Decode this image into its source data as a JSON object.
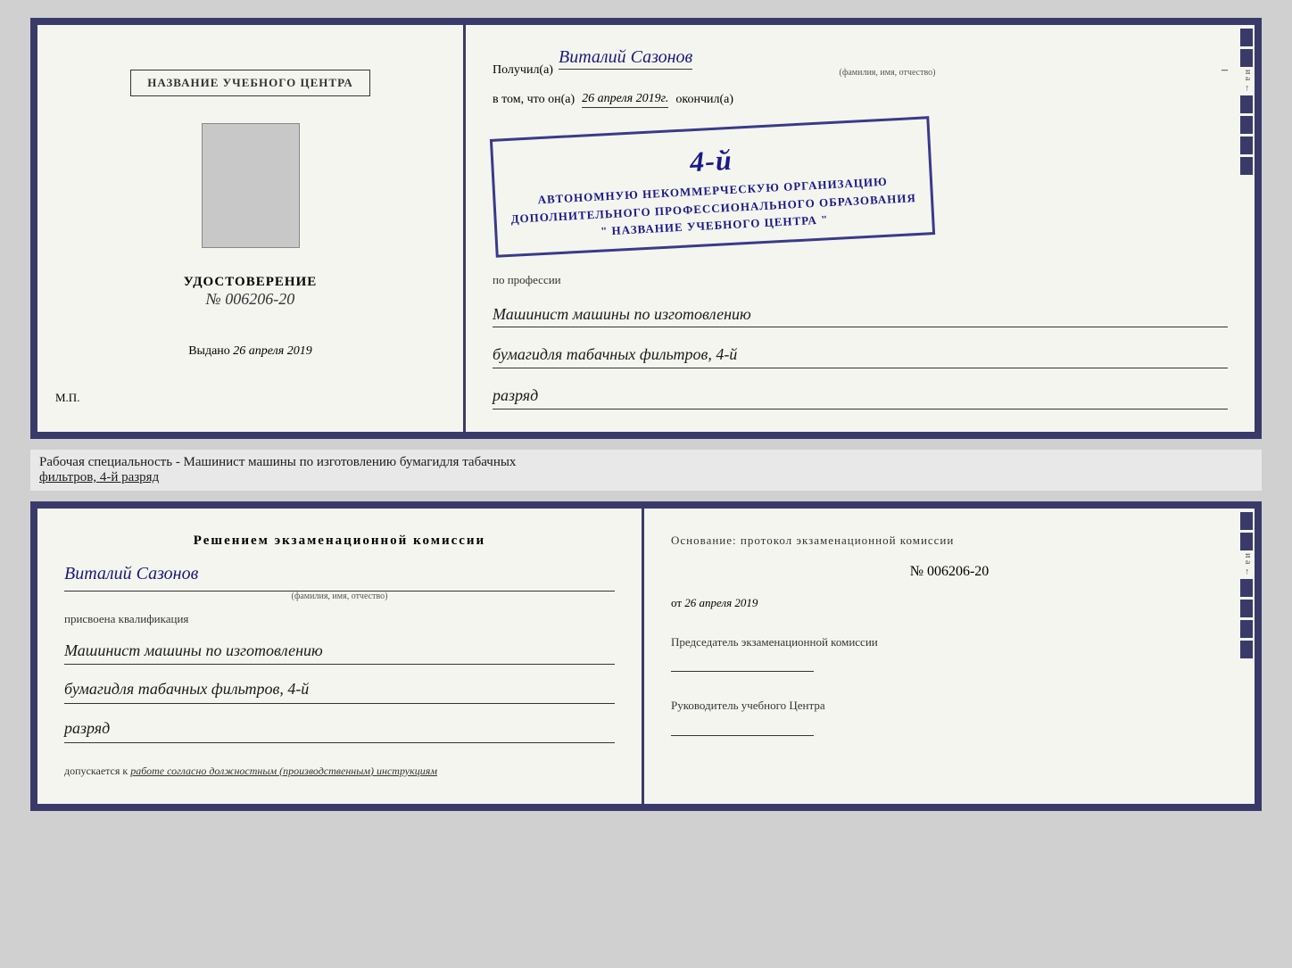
{
  "top_left": {
    "header_label": "НАЗВАНИЕ УЧЕБНОГО ЦЕНТРА",
    "udost_title": "УДОСТОВЕРЕНИЕ",
    "udost_number": "№ 006206-20",
    "issued_label": "Выдано",
    "issued_date": "26 апреля 2019",
    "mp_label": "М.П."
  },
  "top_right": {
    "received_prefix": "Получил(а)",
    "recipient_name": "Виталий Сазонов",
    "fio_hint": "(фамилия, имя, отчество)",
    "in_that_prefix": "в том, что он(а)",
    "date_value": "26 апреля 2019г.",
    "finished_label": "окончил(а)",
    "stamp_line1": "АВТОНОМНУЮ НЕКОММЕРЧЕСКУЮ ОРГАНИЗАЦИЮ",
    "stamp_line2": "ДОПОЛНИТЕЛЬНОГО ПРОФЕССИОНАЛЬНОГО ОБРАЗОВАНИЯ",
    "stamp_line3": "\" НАЗВАНИЕ УЧЕБНОГО ЦЕНТРА \"",
    "stamp_number": "4-й",
    "profession_label": "по профессии",
    "profession_line1": "Машинист машины по изготовлению",
    "profession_line2": "бумагидля табачных фильтров, 4-й",
    "profession_line3": "разряд"
  },
  "caption": {
    "text": "Рабочая специальность - Машинист машины по изготовлению бумагидля табачных",
    "text2": "фильтров, 4-й разряд"
  },
  "bottom_left": {
    "decision_header": "Решением  экзаменационной  комиссии",
    "person_name": "Виталий Сазонов",
    "fio_hint": "(фамилия, имя, отчество)",
    "qualification_label": "присвоена квалификация",
    "qualification_line1": "Машинист машины по изготовлению",
    "qualification_line2": "бумагидля табачных фильтров, 4-й",
    "qualification_line3": "разряд",
    "admission_label": "допускается к",
    "admission_value": "работе согласно должностным (производственным) инструкциям"
  },
  "bottom_right": {
    "osnov_label": "Основание: протокол экзаменационной  комиссии",
    "protocol_number": "№  006206-20",
    "date_prefix": "от",
    "date_value": "26 апреля 2019",
    "chairman_label": "Председатель экзаменационной комиссии",
    "director_label": "Руководитель учебного Центра"
  },
  "deco_chars": [
    "–",
    "–",
    "и",
    "а",
    "←",
    "–",
    "–",
    "–",
    "–"
  ]
}
